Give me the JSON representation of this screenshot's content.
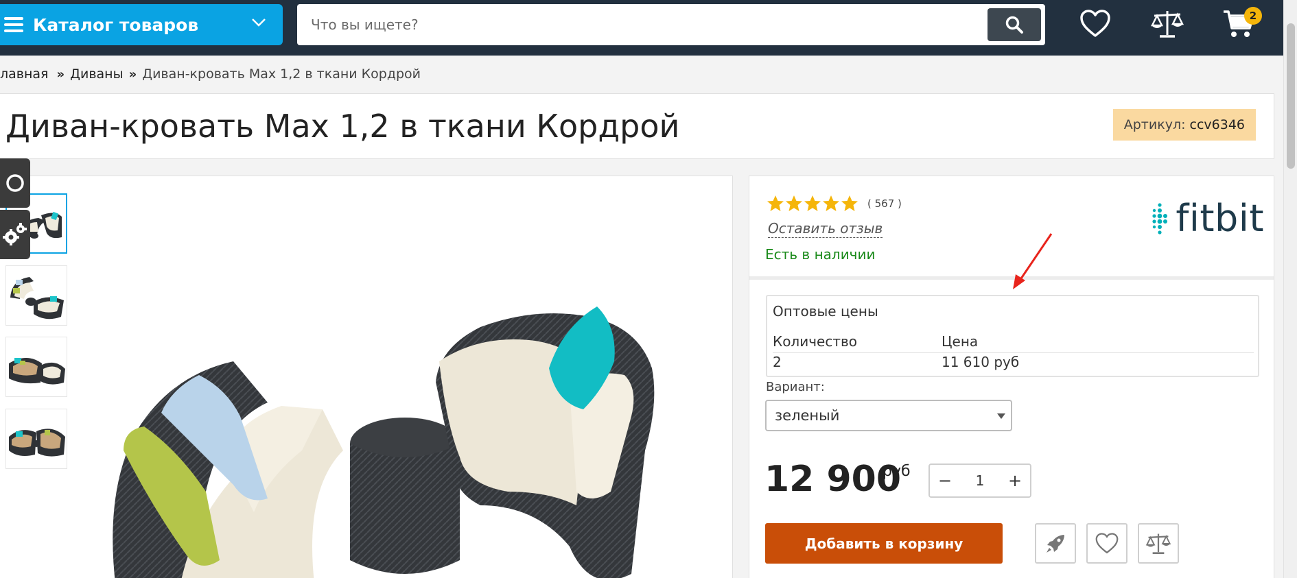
{
  "header": {
    "catalog_label": "Каталог товаров",
    "search_placeholder": "Что вы ищете?",
    "cart_count": "2"
  },
  "breadcrumb": {
    "items": [
      "лавная",
      "Диваны"
    ],
    "current": "Диван-кровать Max 1,2 в ткани Кордрой",
    "separator": "»"
  },
  "product": {
    "title": "Диван-кровать Max 1,2 в ткани Кордрой",
    "sku_label": "Артикул:",
    "sku_value": "ccv6346",
    "rating_stars": 5,
    "reviews_count": "( 567 )",
    "leave_review": "Оставить отзыв",
    "availability": "Есть в наличии",
    "brand": "fitbit",
    "wholesale": {
      "title": "Оптовые цены",
      "col_qty": "Количество",
      "col_price": "Цена",
      "rows": [
        {
          "qty": "2",
          "price": "11 610 руб"
        }
      ]
    },
    "variant_label": "Вариант:",
    "variant_value": "зеленый",
    "price": "12 900",
    "currency": "руб",
    "quantity": "1",
    "stepper_minus": "−",
    "stepper_plus": "+",
    "add_to_cart": "Добавить в корзину"
  },
  "colors": {
    "topbar": "#22303f",
    "catalog": "#0aa3e3",
    "add_to_cart": "#c94e08",
    "stars": "#f5b50a",
    "in_stock": "#1a8a1a",
    "sku_badge": "#fad9a0",
    "annotation_arrow": "#e8241c"
  },
  "icons": [
    "menu-icon",
    "chevron-down-icon",
    "search-icon",
    "heart-icon",
    "scales-icon",
    "cart-icon",
    "star-icon",
    "rocket-icon",
    "circle-icon",
    "gear-icon",
    "fitbit-dots-icon"
  ]
}
